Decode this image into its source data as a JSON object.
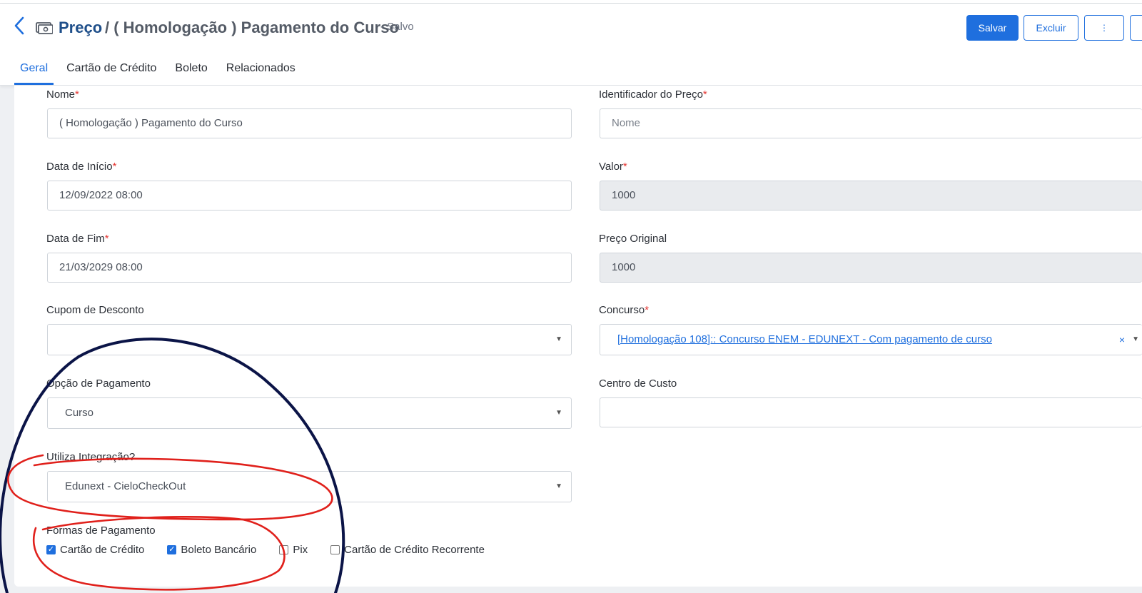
{
  "header": {
    "title": "Preço",
    "breadcrumb": "/ ( Homologação ) Pagamento do Curso",
    "status": "- Salvo",
    "icons": {
      "back": "chevron-left-icon",
      "money": "money-icon"
    }
  },
  "actions": {
    "save_label": "Salvar",
    "delete_label": "Excluir",
    "more_label": "⋮"
  },
  "tabs": [
    {
      "label": "Geral",
      "active": true
    },
    {
      "label": "Cartão de Crédito",
      "active": false
    },
    {
      "label": "Boleto",
      "active": false
    },
    {
      "label": "Relacionados",
      "active": false
    }
  ],
  "form": {
    "nome": {
      "label": "Nome",
      "value": "( Homologação ) Pagamento do Curso"
    },
    "identificador": {
      "label": "Identificador do Preço",
      "placeholder": "Nome"
    },
    "data_inicio": {
      "label": "Data de Início",
      "value": "12/09/2022 08:00"
    },
    "valor": {
      "label": "Valor",
      "value": "1000"
    },
    "data_fim": {
      "label": "Data de Fim",
      "value": "21/03/2029 08:00"
    },
    "preco_original": {
      "label": "Preço Original",
      "value": "1000"
    },
    "cupom": {
      "label": "Cupom de Desconto",
      "value": ""
    },
    "concurso": {
      "label": "Concurso",
      "value": "[Homologação 108]:: Concurso ENEM - EDUNEXT - Com pagamento de curso",
      "clear": "×"
    },
    "opcao_pagamento": {
      "label": "Opção de Pagamento",
      "value": "Curso"
    },
    "centro_custo": {
      "label": "Centro de Custo",
      "value": ""
    },
    "integracao": {
      "label": "Utiliza Integração?",
      "value": "Edunext - CieloCheckOut"
    },
    "formas": {
      "label": "Formas de Pagamento",
      "options": [
        {
          "label": "Cartão de Crédito",
          "checked": true
        },
        {
          "label": "Boleto Bancário",
          "checked": true
        },
        {
          "label": "Pix",
          "checked": false
        },
        {
          "label": "Cartão de Crédito Recorrente",
          "checked": false
        }
      ]
    }
  },
  "required_mark": "*",
  "colors": {
    "primary": "#1f6fde",
    "annotation_circle": "#0b1447",
    "annotation_red": "#e0201b"
  }
}
